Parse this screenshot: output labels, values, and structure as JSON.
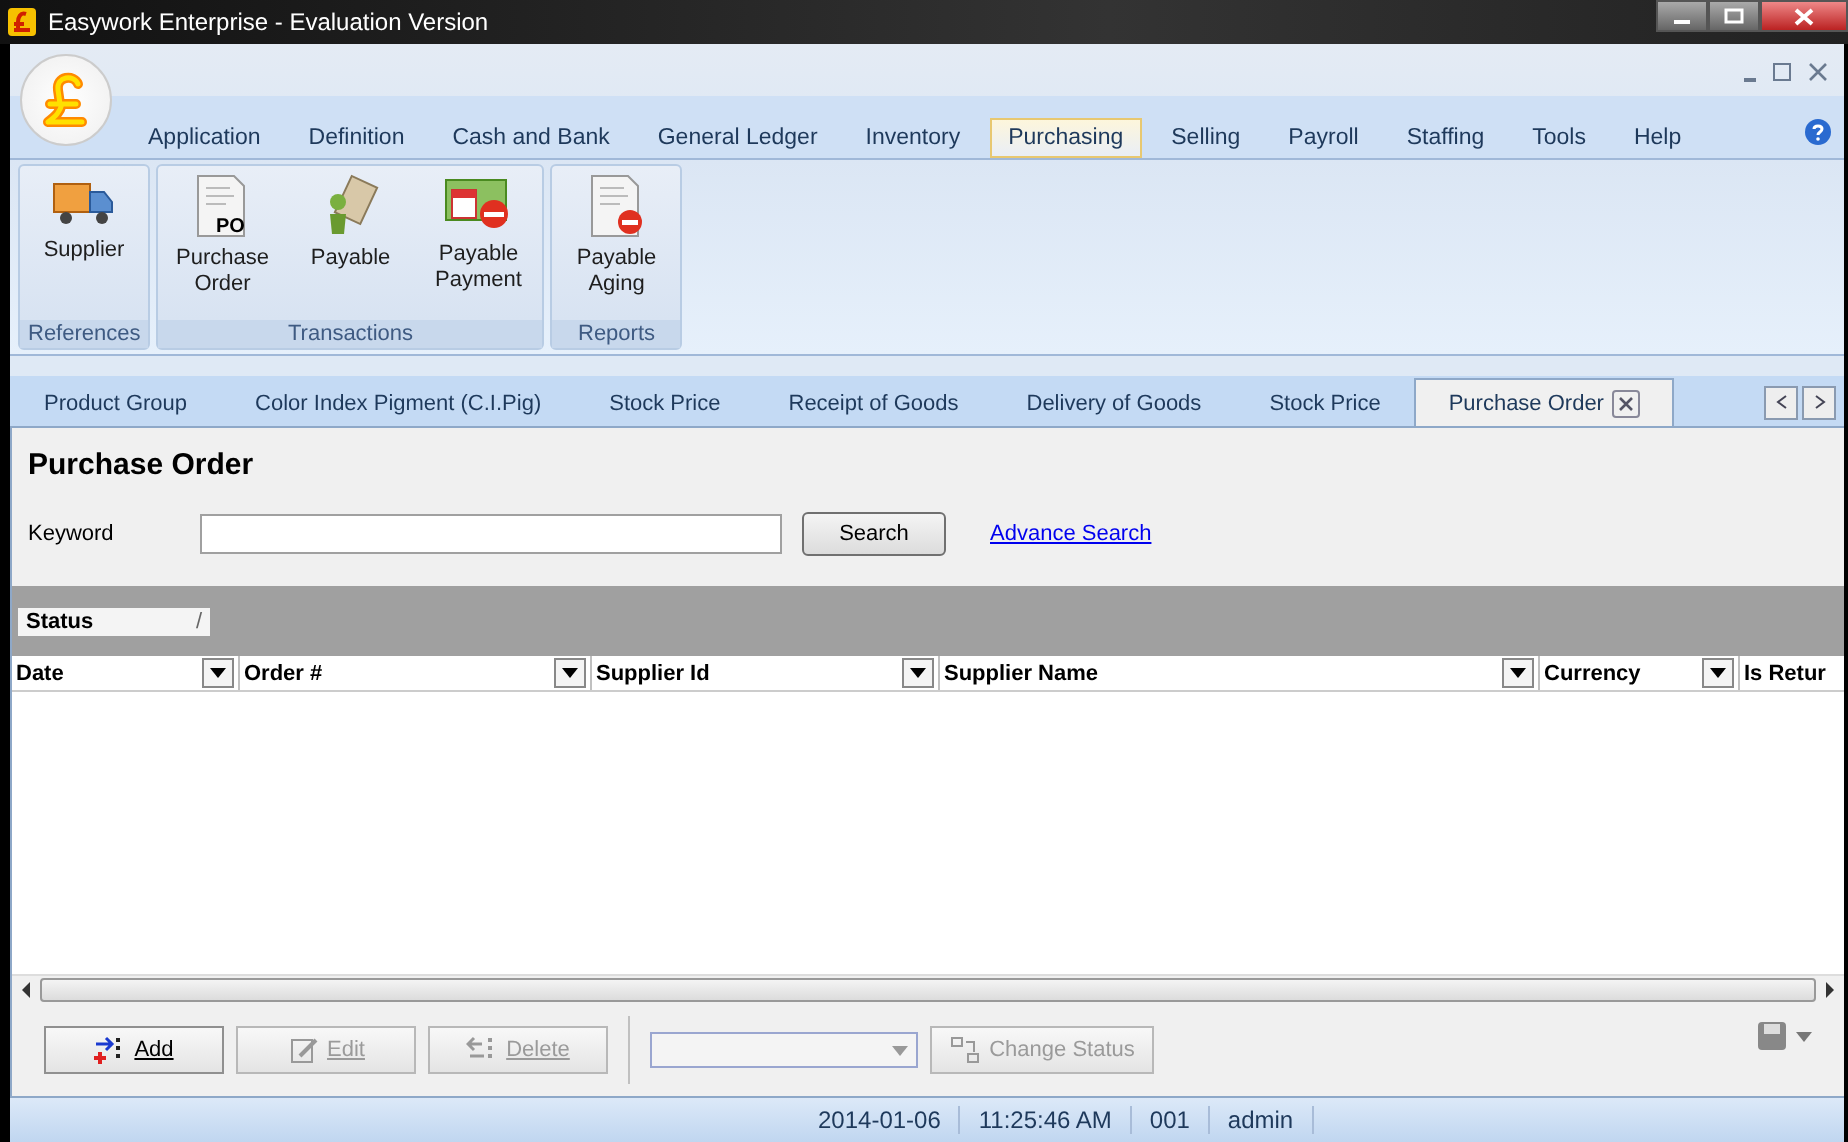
{
  "window": {
    "title": "Easywork Enterprise - Evaluation Version"
  },
  "menu": [
    {
      "label": "Application",
      "selected": false
    },
    {
      "label": "Definition",
      "selected": false
    },
    {
      "label": "Cash and Bank",
      "selected": false
    },
    {
      "label": "General Ledger",
      "selected": false
    },
    {
      "label": "Inventory",
      "selected": false
    },
    {
      "label": "Purchasing",
      "selected": true
    },
    {
      "label": "Selling",
      "selected": false
    },
    {
      "label": "Payroll",
      "selected": false
    },
    {
      "label": "Staffing",
      "selected": false
    },
    {
      "label": "Tools",
      "selected": false
    },
    {
      "label": "Help",
      "selected": false
    }
  ],
  "ribbon": [
    {
      "caption": "References",
      "items": [
        {
          "label": "Supplier",
          "kind": "truck"
        }
      ]
    },
    {
      "caption": "Transactions",
      "items": [
        {
          "label": "Purchase Order",
          "kind": "po",
          "badge": "PO"
        },
        {
          "label": "Payable",
          "kind": "payable"
        },
        {
          "label": "Payable Payment",
          "kind": "payment"
        }
      ]
    },
    {
      "caption": "Reports",
      "items": [
        {
          "label": "Payable Aging",
          "kind": "aging"
        }
      ]
    }
  ],
  "doc_tabs": [
    {
      "label": "Product Group",
      "selected": false
    },
    {
      "label": "Color Index Pigment (C.I.Pig)",
      "selected": false
    },
    {
      "label": "Stock Price",
      "selected": false
    },
    {
      "label": "Receipt of Goods",
      "selected": false
    },
    {
      "label": "Delivery of Goods",
      "selected": false
    },
    {
      "label": "Stock Price",
      "selected": false
    },
    {
      "label": "Purchase Order",
      "selected": true
    }
  ],
  "page": {
    "title": "Purchase Order",
    "keyword_label": "Keyword",
    "search_button": "Search",
    "advance_link": "Advance Search"
  },
  "group_panel": {
    "chips": [
      {
        "label": "Status",
        "sort": "/"
      }
    ]
  },
  "table": {
    "columns": [
      {
        "label": "Date",
        "filter": true
      },
      {
        "label": "Order #",
        "filter": true
      },
      {
        "label": "Supplier Id",
        "filter": true
      },
      {
        "label": "Supplier Name",
        "filter": true
      },
      {
        "label": "Currency",
        "filter": true
      },
      {
        "label": "Is Retur",
        "filter": false
      }
    ]
  },
  "toolbar": {
    "buttons": [
      {
        "label": "Add",
        "kind": "add",
        "disabled": false
      },
      {
        "label": "Edit",
        "kind": "edit",
        "disabled": true
      },
      {
        "label": "Delete",
        "kind": "delete",
        "disabled": true
      }
    ],
    "status_combo": {
      "disabled": true
    },
    "change_status": {
      "label": "Change Status",
      "disabled": true
    }
  },
  "status_bar": [
    "2014-01-06",
    "11:25:46 AM",
    "001",
    "admin"
  ]
}
